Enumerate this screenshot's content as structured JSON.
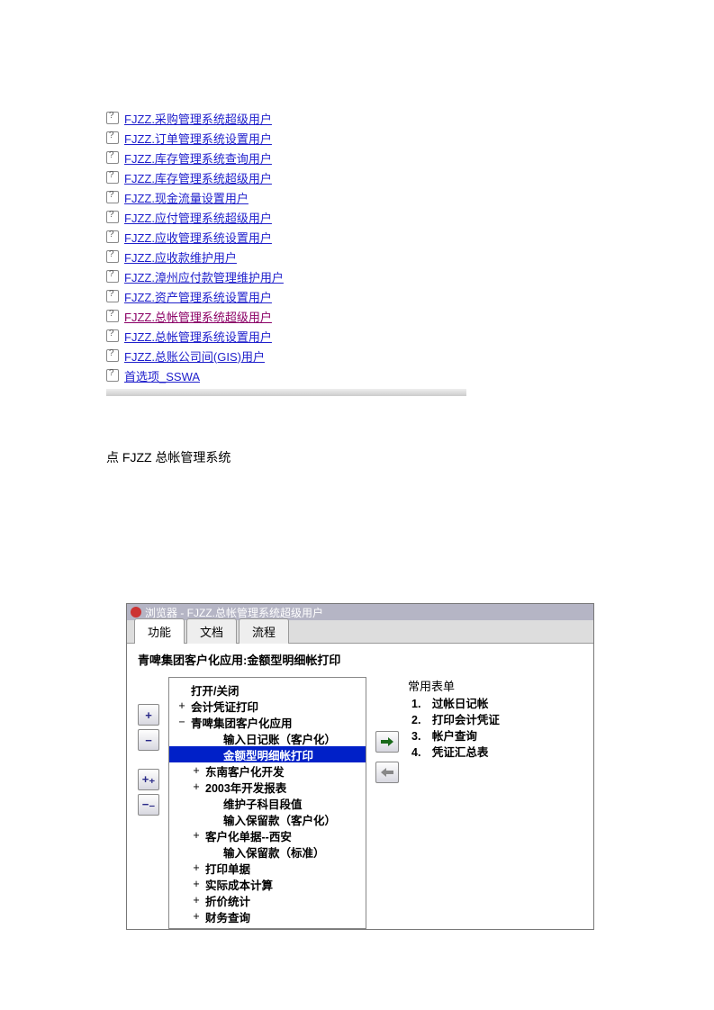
{
  "links": [
    {
      "label": "FJZZ.采购管理系统超级用户",
      "visited": false
    },
    {
      "label": "FJZZ.订单管理系统设置用户",
      "visited": false
    },
    {
      "label": "FJZZ.库存管理系统查询用户",
      "visited": false
    },
    {
      "label": "FJZZ.库存管理系统超级用户",
      "visited": false
    },
    {
      "label": "FJZZ.现金流量设置用户",
      "visited": false
    },
    {
      "label": "FJZZ.应付管理系统超级用户",
      "visited": false
    },
    {
      "label": "FJZZ.应收管理系统设置用户",
      "visited": false
    },
    {
      "label": "FJZZ.应收款维护用户",
      "visited": false
    },
    {
      "label": "FJZZ.漳州应付款管理维护用户",
      "visited": false
    },
    {
      "label": "FJZZ.资产管理系统设置用户",
      "visited": false
    },
    {
      "label": "FJZZ.总帐管理系统超级用户",
      "visited": true
    },
    {
      "label": "FJZZ.总帐管理系统设置用户",
      "visited": false
    },
    {
      "label": "FJZZ.总账公司间(GIS)用户",
      "visited": false
    },
    {
      "label": "首选项_SSWA",
      "visited": false
    }
  ],
  "instruction": "点 FJZZ 总帐管理系统",
  "browser": {
    "title": "浏览器 - FJZZ.总帐管理系统超级用户",
    "tabs": [
      {
        "label": "功能",
        "active": true
      },
      {
        "label": "文档",
        "active": false
      },
      {
        "label": "流程",
        "active": false
      }
    ],
    "breadcrumb": "青啤集团客户化应用:金额型明细帐打印",
    "buttons": {
      "expand": "+",
      "collapse": "−",
      "expand_all": "+₊",
      "collapse_all": "−₋"
    },
    "tree": [
      {
        "exp": "",
        "label": "打开/关闭",
        "indent": 0,
        "selected": false
      },
      {
        "exp": "+",
        "label": "会计凭证打印",
        "indent": 0,
        "selected": false
      },
      {
        "exp": "−",
        "label": "青啤集团客户化应用",
        "indent": 0,
        "selected": false
      },
      {
        "exp": "",
        "label": "输入日记账（客户化）",
        "indent": 2,
        "selected": false
      },
      {
        "exp": "",
        "label": "金额型明细帐打印",
        "indent": 2,
        "selected": true
      },
      {
        "exp": "+",
        "label": "东南客户化开发",
        "indent": 1,
        "selected": false
      },
      {
        "exp": "+",
        "label": "2003年开发报表",
        "indent": 1,
        "selected": false
      },
      {
        "exp": "",
        "label": "维护子科目段值",
        "indent": 2,
        "selected": false
      },
      {
        "exp": "",
        "label": "输入保留款（客户化）",
        "indent": 2,
        "selected": false
      },
      {
        "exp": "+",
        "label": "客户化单据--西安",
        "indent": 1,
        "selected": false
      },
      {
        "exp": "",
        "label": "输入保留款（标准）",
        "indent": 2,
        "selected": false
      },
      {
        "exp": "+",
        "label": "打印单据",
        "indent": 1,
        "selected": false
      },
      {
        "exp": "+",
        "label": "实际成本计算",
        "indent": 1,
        "selected": false
      },
      {
        "exp": "+",
        "label": "折价统计",
        "indent": 1,
        "selected": false
      },
      {
        "exp": "+",
        "label": "财务查询",
        "indent": 1,
        "selected": false
      }
    ],
    "forms_header": "常用表单",
    "forms": [
      "过帐日记帐",
      "打印会计凭证",
      "帐户查询",
      "凭证汇总表"
    ]
  }
}
